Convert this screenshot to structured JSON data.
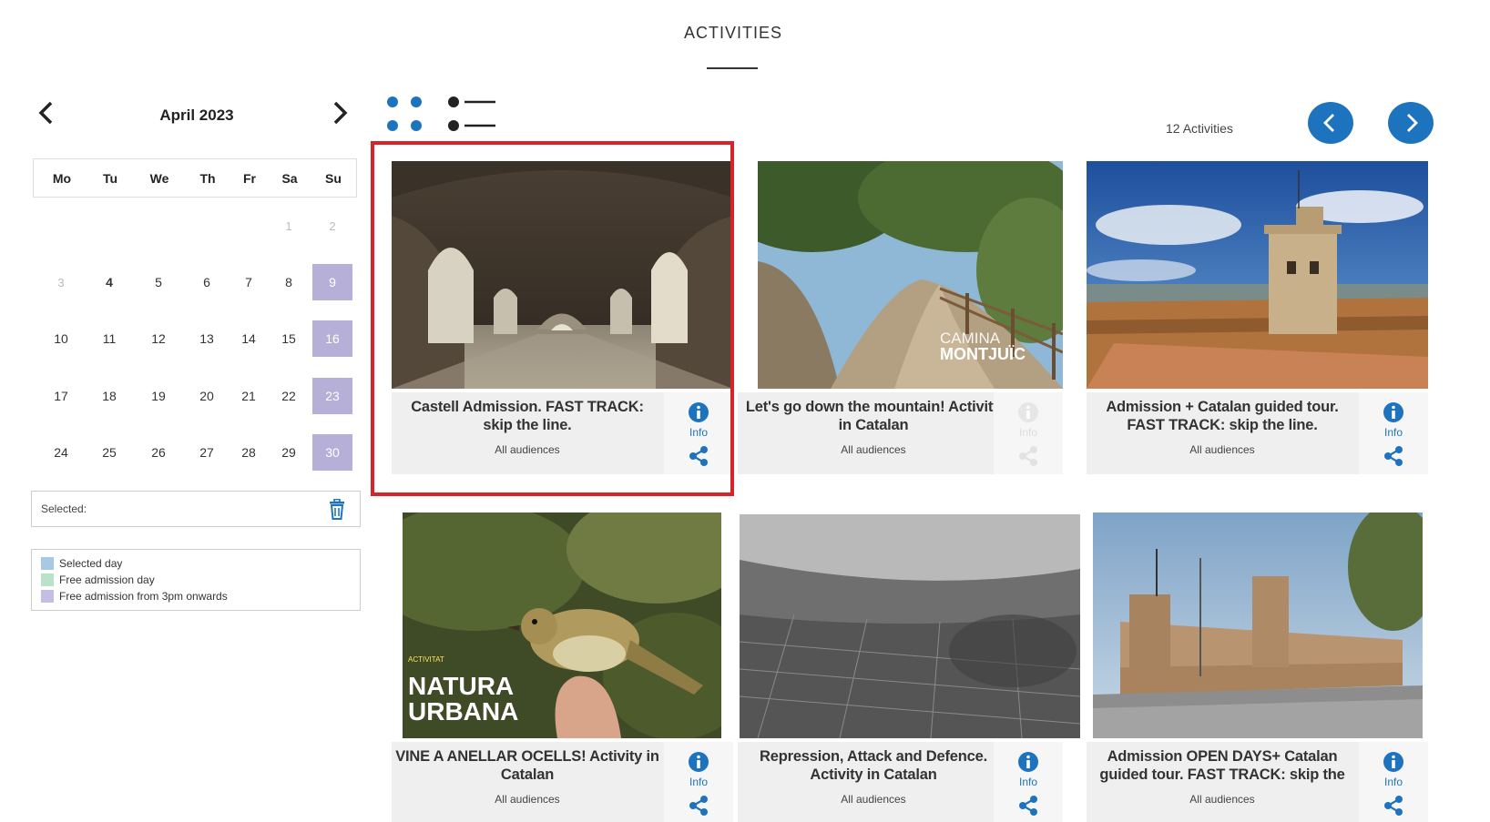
{
  "header": {
    "title": "ACTIVITIES"
  },
  "calendar": {
    "month": "April 2023",
    "weekdays": [
      "Mo",
      "Tu",
      "We",
      "Th",
      "Fr",
      "Sa",
      "Su"
    ],
    "rows": [
      [
        "",
        "",
        "",
        "",
        "",
        "1",
        "2"
      ],
      [
        "3",
        "4",
        "5",
        "6",
        "7",
        "8",
        "9"
      ],
      [
        "10",
        "11",
        "12",
        "13",
        "14",
        "15",
        "16"
      ],
      [
        "17",
        "18",
        "19",
        "20",
        "21",
        "22",
        "23"
      ],
      [
        "24",
        "25",
        "26",
        "27",
        "28",
        "29",
        "30"
      ]
    ],
    "selected_label": "Selected:",
    "legend": [
      {
        "label": "Selected day",
        "color": "#a8c8e6"
      },
      {
        "label": "Free admission day",
        "color": "#b9e2c8"
      },
      {
        "label": "Free admission from 3pm onwards",
        "color": "#c4bde4"
      }
    ]
  },
  "results": {
    "count": "12 Activities"
  },
  "colors": {
    "accent": "#1e73be",
    "highlight": "#d9232a",
    "free3pm": "#b6afd8"
  },
  "cards": [
    {
      "title": "Castell Admission. FAST TRACK: skip the line.",
      "audience": "All audiences",
      "info": "Info",
      "info_enabled": true
    },
    {
      "title": "Let's go down the mountain! Activity in Catalan",
      "audience": "All audiences",
      "info": "Info",
      "info_enabled": false,
      "overlay1": "CAMINA",
      "overlay2": "MONTJUÏC"
    },
    {
      "title": "Admission + Catalan guided tour. FAST TRACK: skip the line.",
      "audience": "All audiences",
      "info": "Info",
      "info_enabled": true
    },
    {
      "title": "VINE A ANELLAR OCELLS! Activity in Catalan",
      "audience": "All audiences",
      "info": "Info",
      "info_enabled": true,
      "overlay0": "ACTIVITAT",
      "overlay1": "NATURA",
      "overlay2": "URBANA"
    },
    {
      "title": "Repression, Attack and Defence. Activity in Catalan",
      "audience": "All audiences",
      "info": "Info",
      "info_enabled": true
    },
    {
      "title": "Admission OPEN DAYS+ Catalan guided tour. FAST TRACK: skip the",
      "audience": "All audiences",
      "info": "Info",
      "info_enabled": true
    }
  ]
}
